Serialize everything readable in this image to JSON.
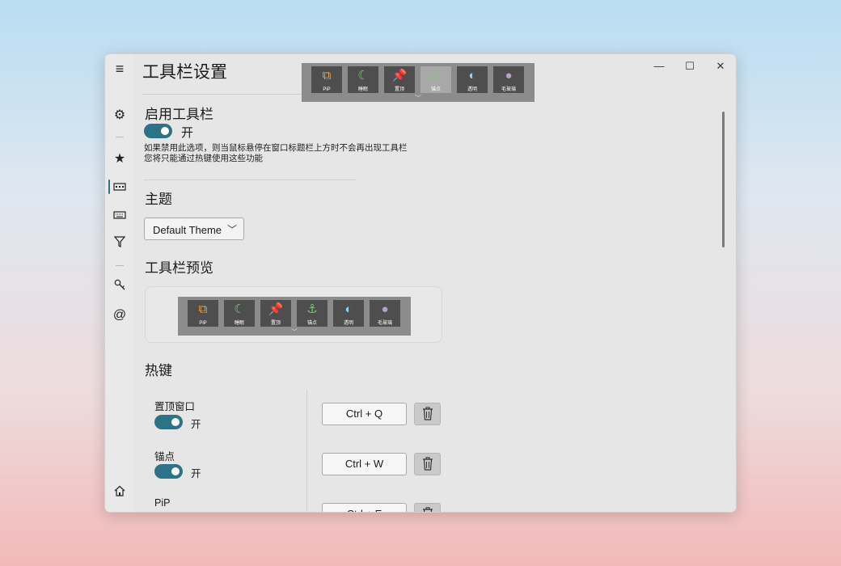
{
  "window": {
    "title": "工具栏设置",
    "minimize_icon": "—",
    "maximize_icon": "☐",
    "close_icon": "✕"
  },
  "nav": {
    "menu_icon": "≡",
    "settings_icon": "⚙",
    "star_icon": "★",
    "toolbar_icon": "▭",
    "keyboard_icon": "⌨",
    "filter_icon": "⧩",
    "key_icon": "⚷",
    "at_icon": "@",
    "home_icon": "⌂"
  },
  "enable_toolbar": {
    "heading": "启用工具栏",
    "toggle_state": "开",
    "description_line1": "如果禁用此选项，则当鼠标悬停在窗口标题栏上方时不会再出现工具栏",
    "description_line2": "您将只能通过热键使用这些功能"
  },
  "theme": {
    "heading": "主题",
    "selected": "Default Theme",
    "chevron": "﹀"
  },
  "preview": {
    "heading": "工具栏预览"
  },
  "toolbar_buttons": [
    {
      "label": "PiP",
      "icon": "pip-icon",
      "glyph": "⧉",
      "color": "#e8a35a"
    },
    {
      "label": "睡眠",
      "icon": "moon-icon",
      "glyph": "☾",
      "color": "#7ec77a"
    },
    {
      "label": "置顶",
      "icon": "pin-icon",
      "glyph": "📌",
      "color": "#e0403a"
    },
    {
      "label": "锚点",
      "icon": "anchor-icon",
      "glyph": "⚓",
      "color": "#7ec77a"
    },
    {
      "label": "透明",
      "icon": "transparency-icon",
      "glyph": "◐",
      "color": "#8fd3f0"
    },
    {
      "label": "毛玻璃",
      "icon": "blur-icon",
      "glyph": "●",
      "color": "#b7a0c8"
    }
  ],
  "hotkeys": {
    "heading": "热键",
    "items": [
      {
        "name": "置顶窗口",
        "toggle": "开",
        "key": "Ctrl + Q"
      },
      {
        "name": "锚点",
        "toggle": "开",
        "key": "Ctrl + W"
      },
      {
        "name": "PiP",
        "toggle": "",
        "key": "Ctrl + E"
      }
    ]
  },
  "colors": {
    "accent": "#2d7388",
    "toolbar_bg": "#8c8c8c",
    "toolbar_button": "#4e4e4e",
    "pink_marker": "#e86aa0"
  }
}
